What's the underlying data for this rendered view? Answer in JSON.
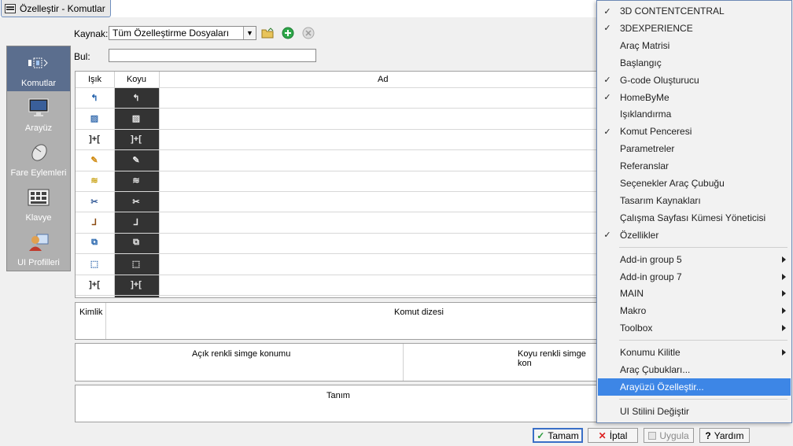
{
  "window": {
    "title": "Özelleştir - Komutlar"
  },
  "nav": {
    "items": [
      {
        "label": "Komutlar",
        "icon": "commands-icon",
        "active": true
      },
      {
        "label": "Arayüz",
        "icon": "monitor-icon",
        "active": false
      },
      {
        "label": "Fare Eylemleri",
        "icon": "mouse-icon",
        "active": false
      },
      {
        "label": "Klavye",
        "icon": "keyboard-icon",
        "active": false
      },
      {
        "label": "UI Profilleri",
        "icon": "user-profile-icon",
        "active": false
      }
    ]
  },
  "source": {
    "label": "Kaynak:",
    "value": "Tüm Özelleştirme Dosyaları",
    "buttons": [
      "open-folder-icon",
      "add-icon",
      "remove-icon"
    ]
  },
  "find": {
    "label": "Bul:",
    "value": ""
  },
  "commands_table": {
    "columns": [
      "Işık",
      "Koyu",
      "Ad"
    ],
    "rows": [
      {
        "light_icon": "↰",
        "dark_icon": "↰"
      },
      {
        "light_icon": "▨",
        "dark_icon": "▨"
      },
      {
        "light_icon": "]+[",
        "dark_icon": "]+["
      },
      {
        "light_icon": "✎",
        "dark_icon": "✎"
      },
      {
        "light_icon": "≋",
        "dark_icon": "≋"
      },
      {
        "light_icon": "✂",
        "dark_icon": "✂"
      },
      {
        "light_icon": "⅃",
        "dark_icon": "⅃"
      },
      {
        "light_icon": "⧉",
        "dark_icon": "⧉"
      },
      {
        "light_icon": "⬚",
        "dark_icon": "⬚"
      },
      {
        "light_icon": "]+[",
        "dark_icon": "]+["
      }
    ]
  },
  "details": {
    "id_label": "Kimlik",
    "command_string_label": "Komut dizesi",
    "light_icon_location_label": "Açık renkli simge konumu",
    "dark_icon_location_label": "Koyu renkli simge kon",
    "description_label": "Tanım"
  },
  "buttons": {
    "ok": "Tamam",
    "cancel": "İptal",
    "apply": "Uygula",
    "help": "Yardım"
  },
  "context_menu": {
    "items": [
      {
        "label": "3D CONTENTCENTRAL",
        "checked": true,
        "submenu": false
      },
      {
        "label": "3DEXPERIENCE",
        "checked": true,
        "submenu": false
      },
      {
        "label": "Araç Matrisi",
        "checked": false,
        "submenu": false
      },
      {
        "label": "Başlangıç",
        "checked": false,
        "submenu": false
      },
      {
        "label": "G-code Oluşturucu",
        "checked": true,
        "submenu": false
      },
      {
        "label": "HomeByMe",
        "checked": true,
        "submenu": false
      },
      {
        "label": "Işıklandırma",
        "checked": false,
        "submenu": false
      },
      {
        "label": "Komut Penceresi",
        "checked": true,
        "submenu": false
      },
      {
        "label": "Parametreler",
        "checked": false,
        "submenu": false
      },
      {
        "label": "Referanslar",
        "checked": false,
        "submenu": false
      },
      {
        "label": "Seçenekler Araç Çubuğu",
        "checked": false,
        "submenu": false
      },
      {
        "label": "Tasarım Kaynakları",
        "checked": false,
        "submenu": false
      },
      {
        "label": "Çalışma Sayfası Kümesi Yöneticisi",
        "checked": false,
        "submenu": false
      },
      {
        "label": "Özellikler",
        "checked": true,
        "submenu": false
      },
      {
        "label": "Add-in group 5",
        "checked": false,
        "submenu": true
      },
      {
        "label": "Add-in group 7",
        "checked": false,
        "submenu": true
      },
      {
        "label": "MAIN",
        "checked": false,
        "submenu": true
      },
      {
        "label": "Makro",
        "checked": false,
        "submenu": true
      },
      {
        "label": "Toolbox",
        "checked": false,
        "submenu": true
      },
      {
        "label": "Konumu Kilitle",
        "checked": false,
        "submenu": true
      },
      {
        "label": "Araç Çubukları...",
        "checked": false,
        "submenu": false
      },
      {
        "label": "Arayüzü Özelleştir...",
        "checked": false,
        "submenu": false,
        "highlighted": true
      },
      {
        "label": "UI Stilini Değiştir",
        "checked": false,
        "submenu": false
      }
    ],
    "check_glyph": "✓"
  },
  "colors": {
    "accent": "#3d86e6",
    "nav_active": "#5b6e8e",
    "nav_bg": "#b0b0b0",
    "dark_column": "#333333"
  }
}
